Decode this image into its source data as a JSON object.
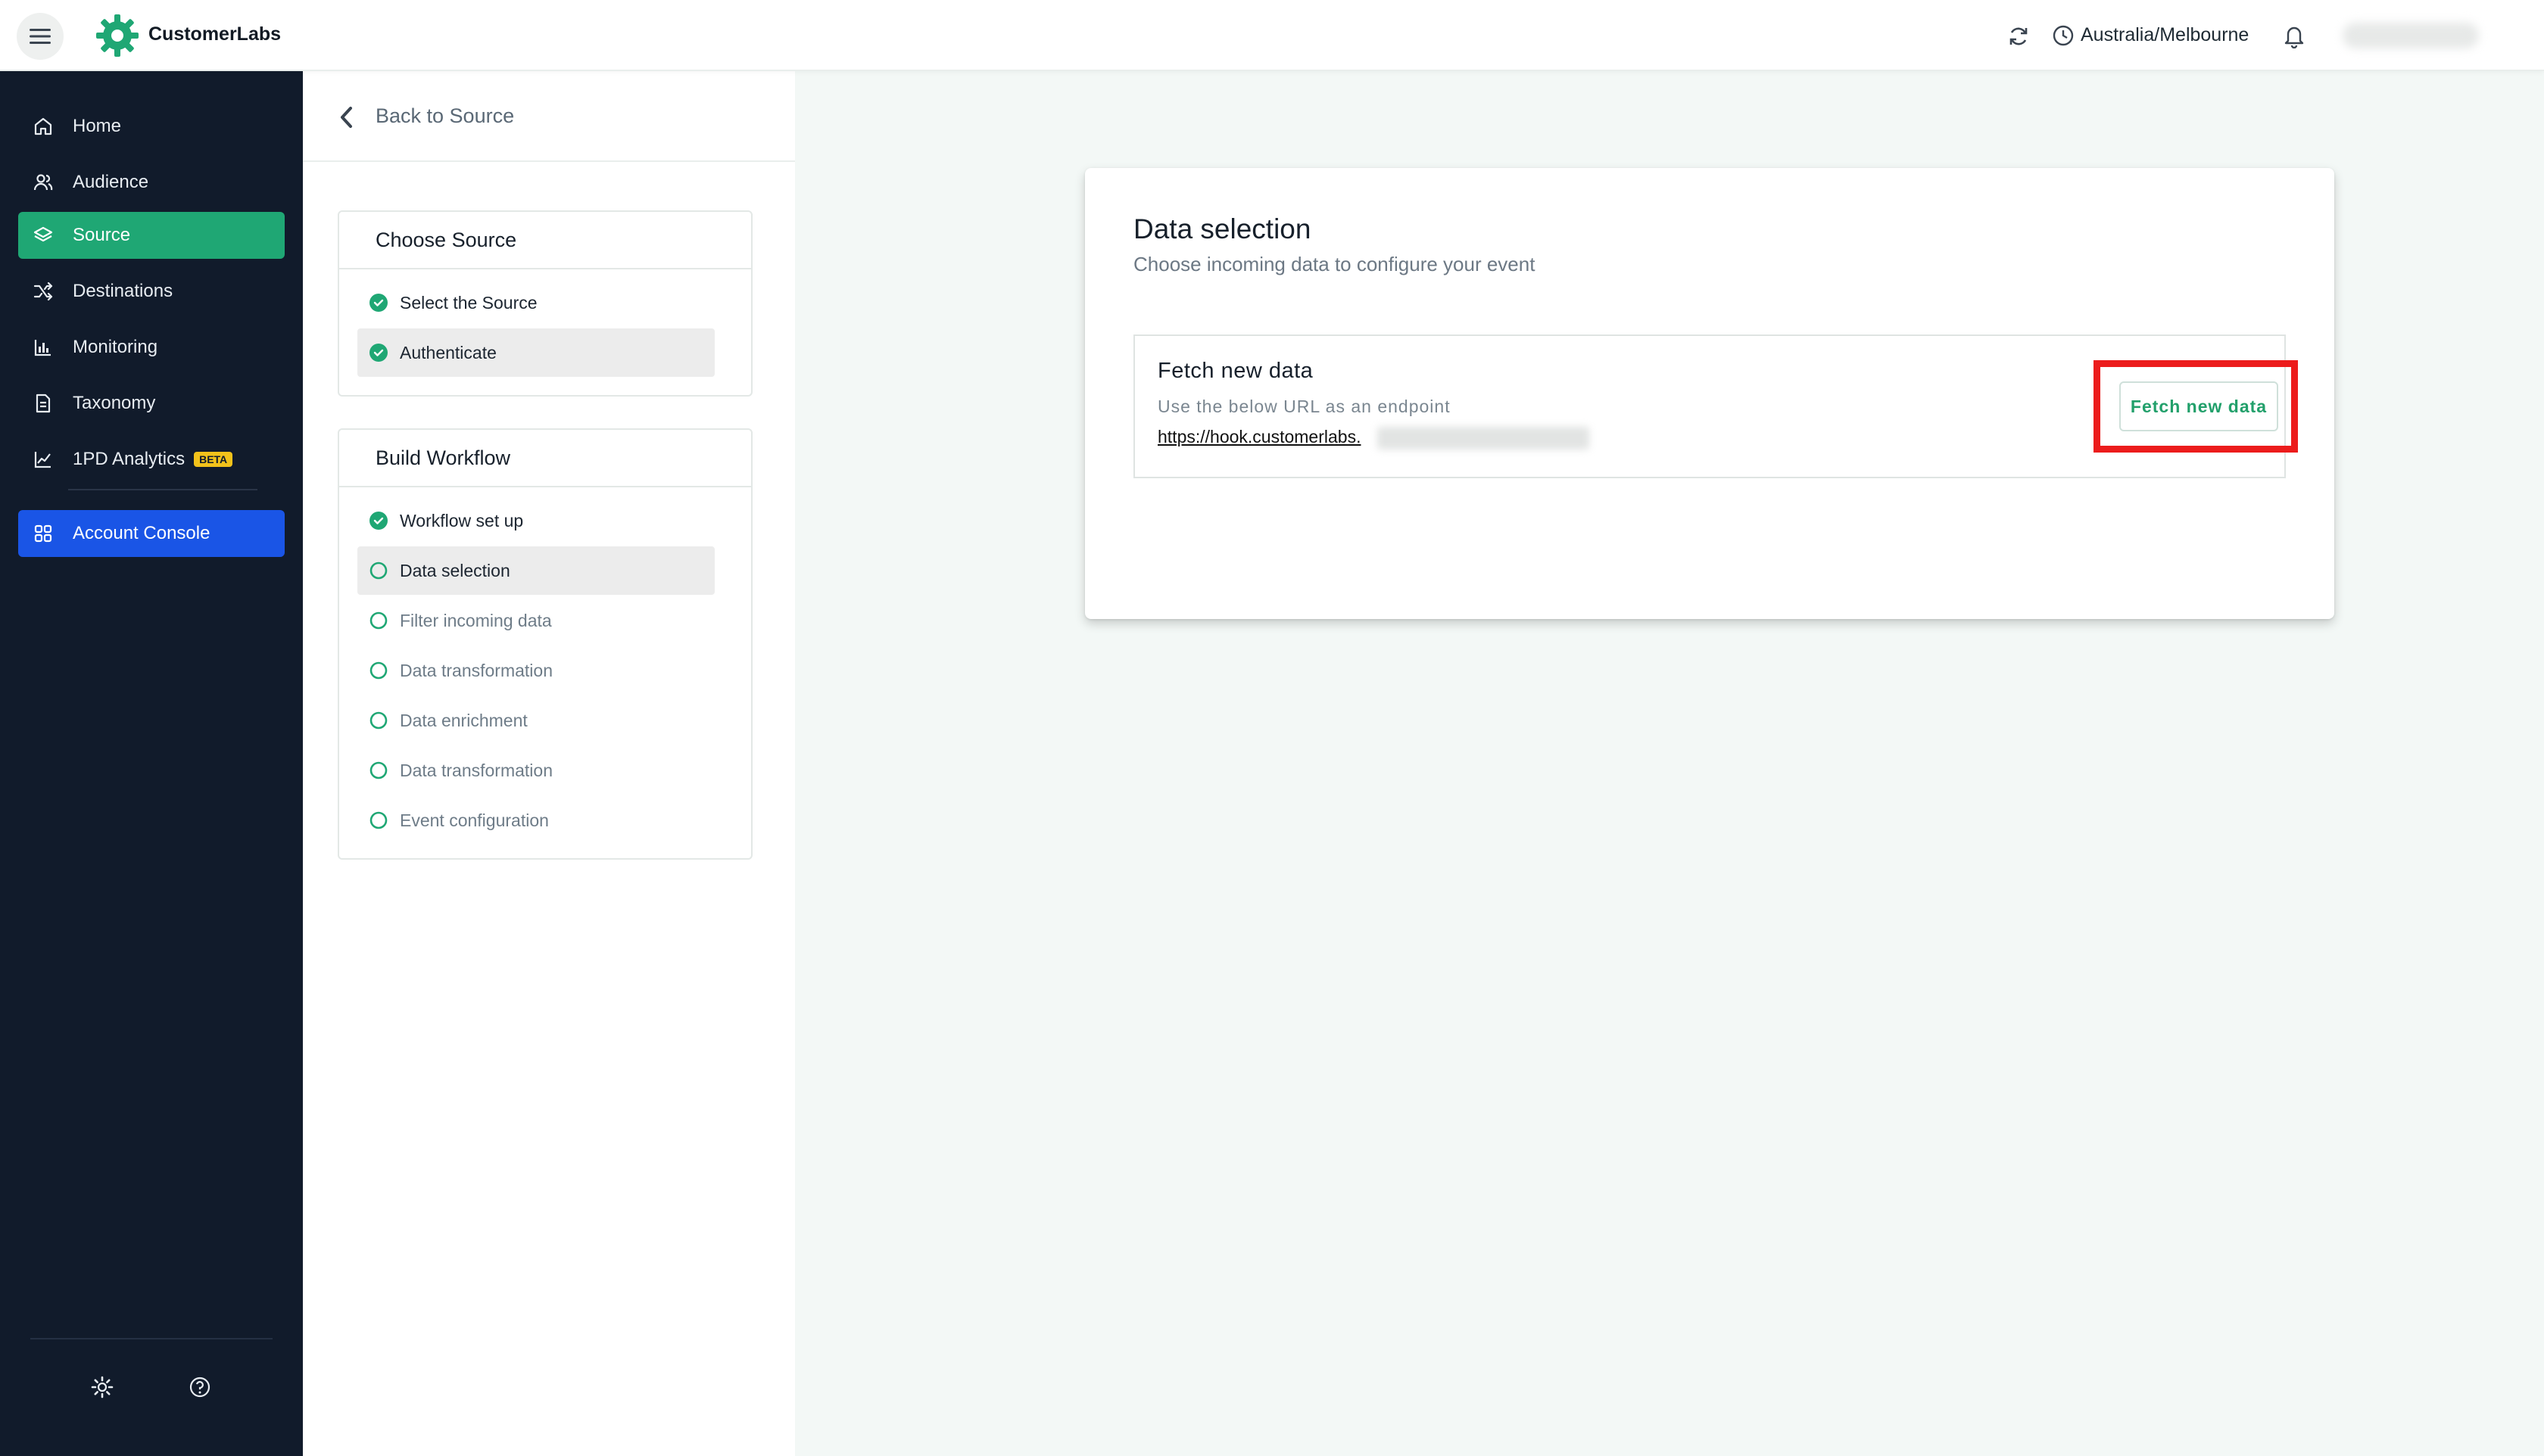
{
  "header": {
    "brand": "CustomerLabs",
    "timezone": "Australia/Melbourne"
  },
  "sidebar": {
    "items": [
      {
        "label": "Home",
        "icon": "home-icon"
      },
      {
        "label": "Audience",
        "icon": "users-icon"
      },
      {
        "label": "Source",
        "icon": "layers-icon",
        "active": true
      },
      {
        "label": "Destinations",
        "icon": "shuffle-icon"
      },
      {
        "label": "Monitoring",
        "icon": "bar-chart-icon"
      },
      {
        "label": "Taxonomy",
        "icon": "document-icon"
      },
      {
        "label": "1PD Analytics",
        "icon": "line-chart-icon",
        "badge": "BETA"
      }
    ],
    "console_label": "Account Console"
  },
  "steps_panel": {
    "back_label": "Back to Source",
    "choose_source": {
      "title": "Choose Source",
      "steps": [
        {
          "label": "Select the Source",
          "status": "done"
        },
        {
          "label": "Authenticate",
          "status": "done"
        }
      ]
    },
    "build_workflow": {
      "title": "Build Workflow",
      "steps": [
        {
          "label": "Workflow set up",
          "status": "done"
        },
        {
          "label": "Data selection",
          "status": "current"
        },
        {
          "label": "Filter incoming data",
          "status": "pending"
        },
        {
          "label": "Data transformation",
          "status": "pending"
        },
        {
          "label": "Data enrichment",
          "status": "pending"
        },
        {
          "label": "Data transformation",
          "status": "pending"
        },
        {
          "label": "Event configuration",
          "status": "pending"
        }
      ]
    }
  },
  "main": {
    "title": "Data selection",
    "subtitle": "Choose incoming data to configure your event",
    "fetch": {
      "title": "Fetch new data",
      "description": "Use the below URL as an endpoint",
      "url": "https://hook.customerlabs.",
      "button_label": "Fetch new data"
    }
  },
  "colors": {
    "sidebar_bg": "#111b2b",
    "active_green": "#1fa774",
    "console_blue": "#1a55e6",
    "highlight_red": "#ec1c1c"
  }
}
